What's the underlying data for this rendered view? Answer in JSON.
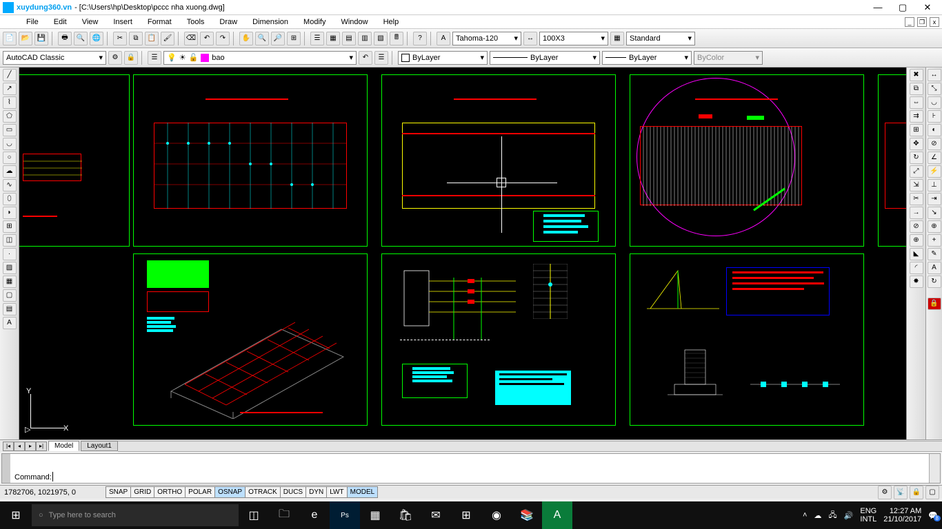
{
  "title_brand": "xuydung360.vn",
  "title_path": " - [C:\\Users\\hp\\Desktop\\pccc nha xuong.dwg]",
  "menu": [
    "File",
    "Edit",
    "View",
    "Insert",
    "Format",
    "Tools",
    "Draw",
    "Dimension",
    "Modify",
    "Window",
    "Help"
  ],
  "workspace": "AutoCAD Classic",
  "layer_name": "bao",
  "font_style": "Tahoma-120",
  "dim_style": "100X3",
  "text_style": "Standard",
  "prop_bylayer": "ByLayer",
  "prop_bylayer2": "ByLayer",
  "prop_bylayer3": "ByLayer",
  "prop_bycolor": "ByColor",
  "tabs": {
    "model": "Model",
    "layout1": "Layout1"
  },
  "command_prompt": "Command: ",
  "status": {
    "coords": "1782706, 1021975, 0",
    "buttons": [
      "SNAP",
      "GRID",
      "ORTHO",
      "POLAR",
      "OSNAP",
      "OTRACK",
      "DUCS",
      "DYN",
      "LWT",
      "MODEL"
    ]
  },
  "taskbar": {
    "search_placeholder": "Type here to search",
    "lang": "ENG",
    "locale": "INTL",
    "time": "12:27 AM",
    "date": "21/10/2017",
    "notif_count": "8"
  }
}
